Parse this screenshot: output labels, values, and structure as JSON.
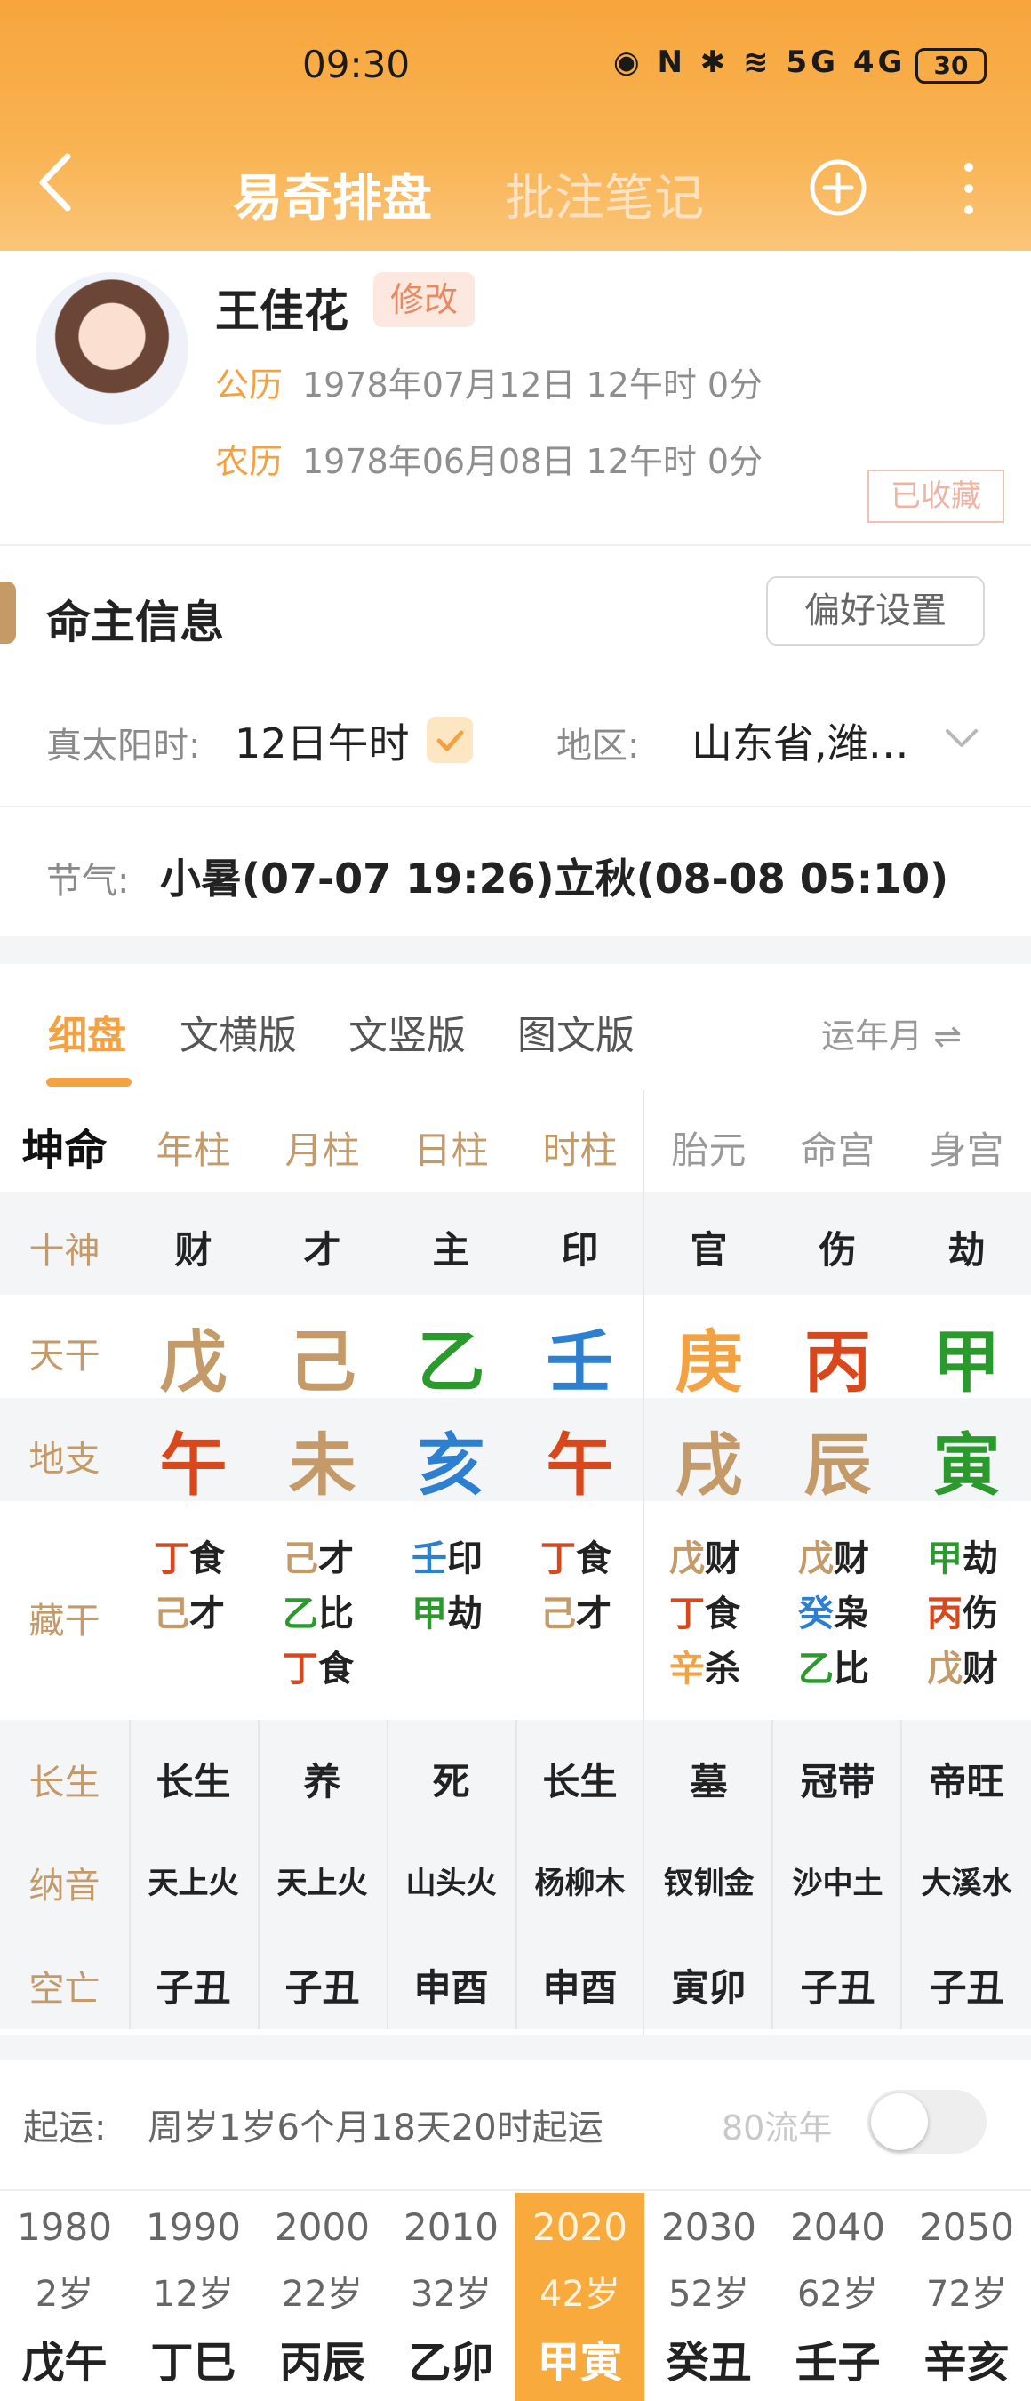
{
  "status_bar": {
    "time": "09:30",
    "icons_text": "◉ N ✱ ≋ 5G 4G",
    "battery": "30"
  },
  "nav": {
    "tabs": [
      "易奇排盘",
      "批注笔记"
    ]
  },
  "profile": {
    "name": "王佳花",
    "edit_label": "修改",
    "solar_label": "公历",
    "solar_value": "1978年07月12日 12午时 0分",
    "lunar_label": "农历",
    "lunar_value": "1978年06月08日 12午时 0分",
    "stamp": "已收藏"
  },
  "info": {
    "title": "命主信息",
    "pref_button": "偏好设置",
    "true_solar_label": "真太阳时:",
    "true_solar_value": "12日午时",
    "region_label": "地区:",
    "region_value": "山东省,潍…",
    "jieqi_label": "节气:",
    "jieqi_value": "小暑(07-07 19:26)立秋(08-08 05:10)"
  },
  "subtabs": {
    "items": [
      "细盘",
      "文横版",
      "文竖版",
      "图文版"
    ],
    "active": 0,
    "yun_label": "运年月 ⇌"
  },
  "colors": {
    "accent": "#f3a243",
    "fire": "#d9481c",
    "earth": "#c49a68",
    "wood": "#2a9a2c",
    "water": "#2d7fd0",
    "metal": "#f3a243"
  },
  "grid": {
    "corner": "坤命",
    "headers": [
      "年柱",
      "月柱",
      "日柱",
      "时柱",
      "胎元",
      "命宫",
      "身宫"
    ],
    "row_labels": [
      "十神",
      "天干",
      "地支",
      "藏干",
      "长生",
      "纳音",
      "空亡"
    ],
    "shishen": [
      "财",
      "才",
      "主",
      "印",
      "官",
      "伤",
      "劫"
    ],
    "tiangan": [
      {
        "char": "戊",
        "color": "#c49a68"
      },
      {
        "char": "己",
        "color": "#c49a68"
      },
      {
        "char": "乙",
        "color": "#2a9a2c"
      },
      {
        "char": "壬",
        "color": "#2d7fd0"
      },
      {
        "char": "庚",
        "color": "#f3a243"
      },
      {
        "char": "丙",
        "color": "#d9481c"
      },
      {
        "char": "甲",
        "color": "#2a9a2c"
      }
    ],
    "dizhi": [
      {
        "char": "午",
        "color": "#d9481c"
      },
      {
        "char": "未",
        "color": "#c49a68"
      },
      {
        "char": "亥",
        "color": "#2d7fd0"
      },
      {
        "char": "午",
        "color": "#d9481c"
      },
      {
        "char": "戌",
        "color": "#c49a68"
      },
      {
        "char": "辰",
        "color": "#c49a68"
      },
      {
        "char": "寅",
        "color": "#2a9a2c"
      }
    ],
    "canggan": [
      [
        {
          "g": "丁",
          "c": "#d9481c",
          "s": "食"
        },
        {
          "g": "己",
          "c": "#c49a68",
          "s": "才"
        }
      ],
      [
        {
          "g": "己",
          "c": "#c49a68",
          "s": "才"
        },
        {
          "g": "乙",
          "c": "#2a9a2c",
          "s": "比"
        },
        {
          "g": "丁",
          "c": "#d9481c",
          "s": "食"
        }
      ],
      [
        {
          "g": "壬",
          "c": "#2d7fd0",
          "s": "印"
        },
        {
          "g": "甲",
          "c": "#2a9a2c",
          "s": "劫"
        }
      ],
      [
        {
          "g": "丁",
          "c": "#d9481c",
          "s": "食"
        },
        {
          "g": "己",
          "c": "#c49a68",
          "s": "才"
        }
      ],
      [
        {
          "g": "戊",
          "c": "#c49a68",
          "s": "财"
        },
        {
          "g": "丁",
          "c": "#d9481c",
          "s": "食"
        },
        {
          "g": "辛",
          "c": "#f3a243",
          "s": "杀"
        }
      ],
      [
        {
          "g": "戊",
          "c": "#c49a68",
          "s": "财"
        },
        {
          "g": "癸",
          "c": "#2d7fd0",
          "s": "枭"
        },
        {
          "g": "乙",
          "c": "#2a9a2c",
          "s": "比"
        }
      ],
      [
        {
          "g": "甲",
          "c": "#2a9a2c",
          "s": "劫"
        },
        {
          "g": "丙",
          "c": "#d9481c",
          "s": "伤"
        },
        {
          "g": "戊",
          "c": "#c49a68",
          "s": "财"
        }
      ]
    ],
    "changsheng": [
      "长生",
      "养",
      "死",
      "长生",
      "墓",
      "冠带",
      "帝旺"
    ],
    "nayin": [
      "天上火",
      "天上火",
      "山头火",
      "杨柳木",
      "钗钏金",
      "沙中土",
      "大溪水"
    ],
    "kongwang": [
      "子丑",
      "子丑",
      "申酉",
      "申酉",
      "寅卯",
      "子丑",
      "子丑"
    ]
  },
  "qiyun": {
    "label": "起运:",
    "value": "周岁1岁6个月18天20时起运",
    "liunian_label": "80流年"
  },
  "dayun": [
    {
      "year": "1980",
      "age": "2岁",
      "gz": "戊午"
    },
    {
      "year": "1990",
      "age": "12岁",
      "gz": "丁巳"
    },
    {
      "year": "2000",
      "age": "22岁",
      "gz": "丙辰"
    },
    {
      "year": "2010",
      "age": "32岁",
      "gz": "乙卯"
    },
    {
      "year": "2020",
      "age": "42岁",
      "gz": "甲寅"
    },
    {
      "year": "2030",
      "age": "52岁",
      "gz": "癸丑"
    },
    {
      "year": "2040",
      "age": "62岁",
      "gz": "壬子"
    },
    {
      "year": "2050",
      "age": "72岁",
      "gz": "辛亥"
    }
  ],
  "dayun_active": 4
}
